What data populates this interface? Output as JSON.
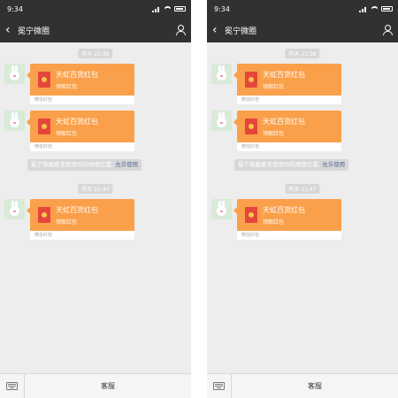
{
  "status_bar": {
    "time": "9:34"
  },
  "nav": {
    "title": "冕宁微圈"
  },
  "messages": [
    {
      "time_label": "昨天 21:38",
      "packet_title": "天虹百货红包",
      "packet_subtitle": "领取红包",
      "packet_footer": "微信红包"
    },
    {
      "packet_title": "天虹百货红包",
      "packet_subtitle": "领取红包",
      "packet_footer": "微信红包"
    },
    {
      "notice_text": "冕宁微圈要求使用你的地理位置,",
      "notice_action": "允许使用"
    },
    {
      "time_label": "昨天 21:47",
      "packet_title": "天虹百货红包",
      "packet_subtitle": "领取红包",
      "packet_footer": "微信红包"
    }
  ],
  "bottom_bar": {
    "service_label": "客服"
  },
  "colors": {
    "header_bg": "#313131",
    "chat_bg": "#ededed",
    "red_packet": "#faa04a",
    "link": "#576b95"
  },
  "icons": [
    "back-arrow-icon",
    "user-icon",
    "keyboard-icon",
    "red-packet-icon"
  ]
}
